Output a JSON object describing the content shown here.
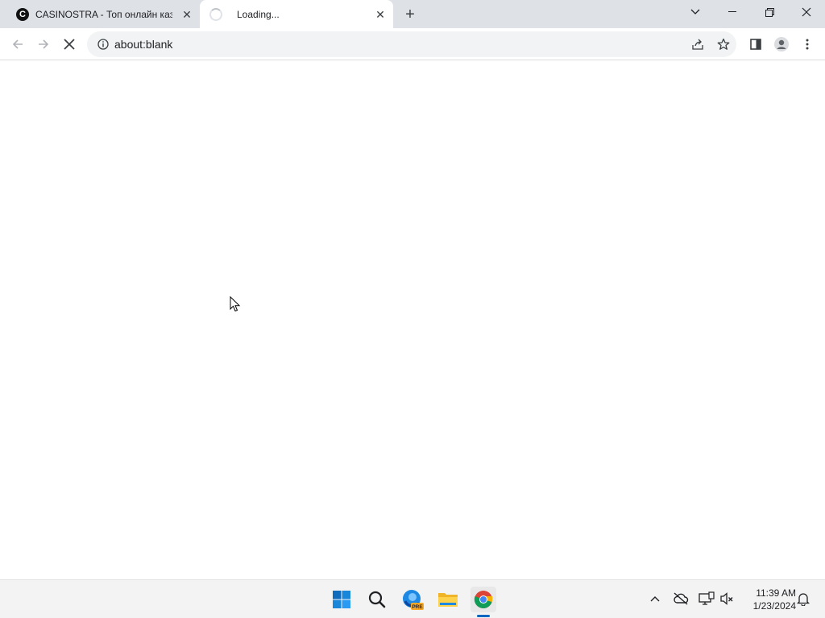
{
  "browser": {
    "tabs": [
      {
        "title": "CASINOSTRA - Топ онлайн кази",
        "favicon_letter": "C"
      },
      {
        "title": "Loading..."
      }
    ],
    "address": {
      "url": "about:blank"
    }
  },
  "icons": [
    "back-arrow-icon",
    "forward-arrow-icon",
    "stop-icon",
    "info-icon",
    "share-icon",
    "bookmark-star-icon",
    "side-panel-icon",
    "profile-icon",
    "menu-dots-icon",
    "windows-start-icon",
    "search-icon",
    "edge-icon",
    "file-explorer-icon",
    "chrome-icon",
    "chevron-up-icon",
    "cloud-off-icon",
    "network-icon",
    "volume-mute-icon",
    "bell-icon"
  ],
  "taskbar": {
    "edge_badge": "PRE",
    "clock": {
      "time": "11:39 AM",
      "date": "1/23/2024"
    }
  },
  "colors": {
    "tabstrip": "#dee1e6",
    "accent": "#0067c0"
  }
}
